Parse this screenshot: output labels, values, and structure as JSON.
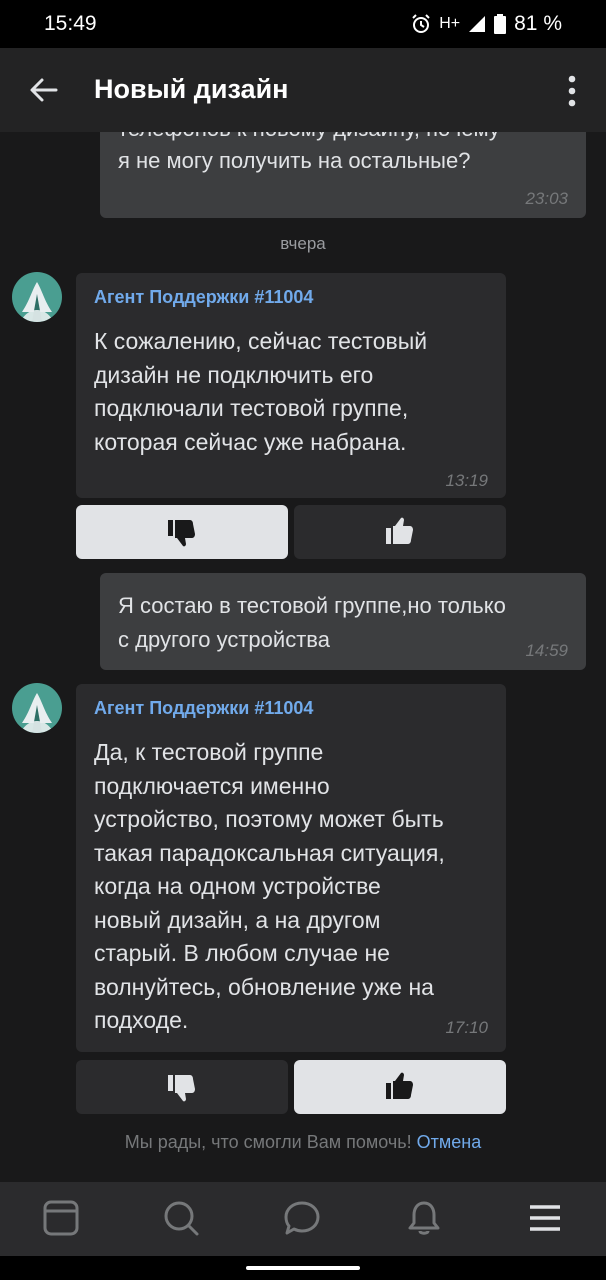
{
  "status": {
    "time": "15:49",
    "network": "H+",
    "battery": "81 %"
  },
  "header": {
    "title": "Новый дизайн"
  },
  "messages": [
    {
      "type": "out",
      "line1": "телефонов к новому дизайну, почему",
      "line2": "я не могу получить на остальные?",
      "time": "23:03"
    },
    {
      "type": "date",
      "text": "вчера"
    },
    {
      "type": "in",
      "sender": "Агент Поддержки #11004",
      "lines": [
        "К сожалению, сейчас тестовый",
        "дизайн не подключить  его",
        "подключали тестовой группе,",
        "которая сейчас уже набрана."
      ],
      "time": "13:19"
    },
    {
      "type": "out",
      "line1": "Я состаю в тестовой группе,но только",
      "line2": "с другого устройства",
      "time": "14:59"
    },
    {
      "type": "in",
      "sender": "Агент Поддержки #11004",
      "lines": [
        "Да, к тестовой группе",
        "подключается именно",
        "устройство, поэтому может быть",
        "такая парадоксальная ситуация,",
        "когда на одном устройстве",
        "новый дизайн, а на другом ",
        "старый. В любом случае не",
        "волнуйтесь, обновление уже на",
        "подходе."
      ],
      "time": "17:10"
    }
  ],
  "rating": {
    "text": "Мы рады, что смогли Вам помочь!",
    "cancel": "Отмена"
  },
  "icons": {
    "thumb_down": "thumb-down-icon",
    "thumb_up": "thumb-up-icon"
  },
  "colors": {
    "accent": "#71aaeb",
    "background": "#19191a",
    "bubble_in": "#2b2b2d",
    "bubble_out": "#3d3e40"
  }
}
